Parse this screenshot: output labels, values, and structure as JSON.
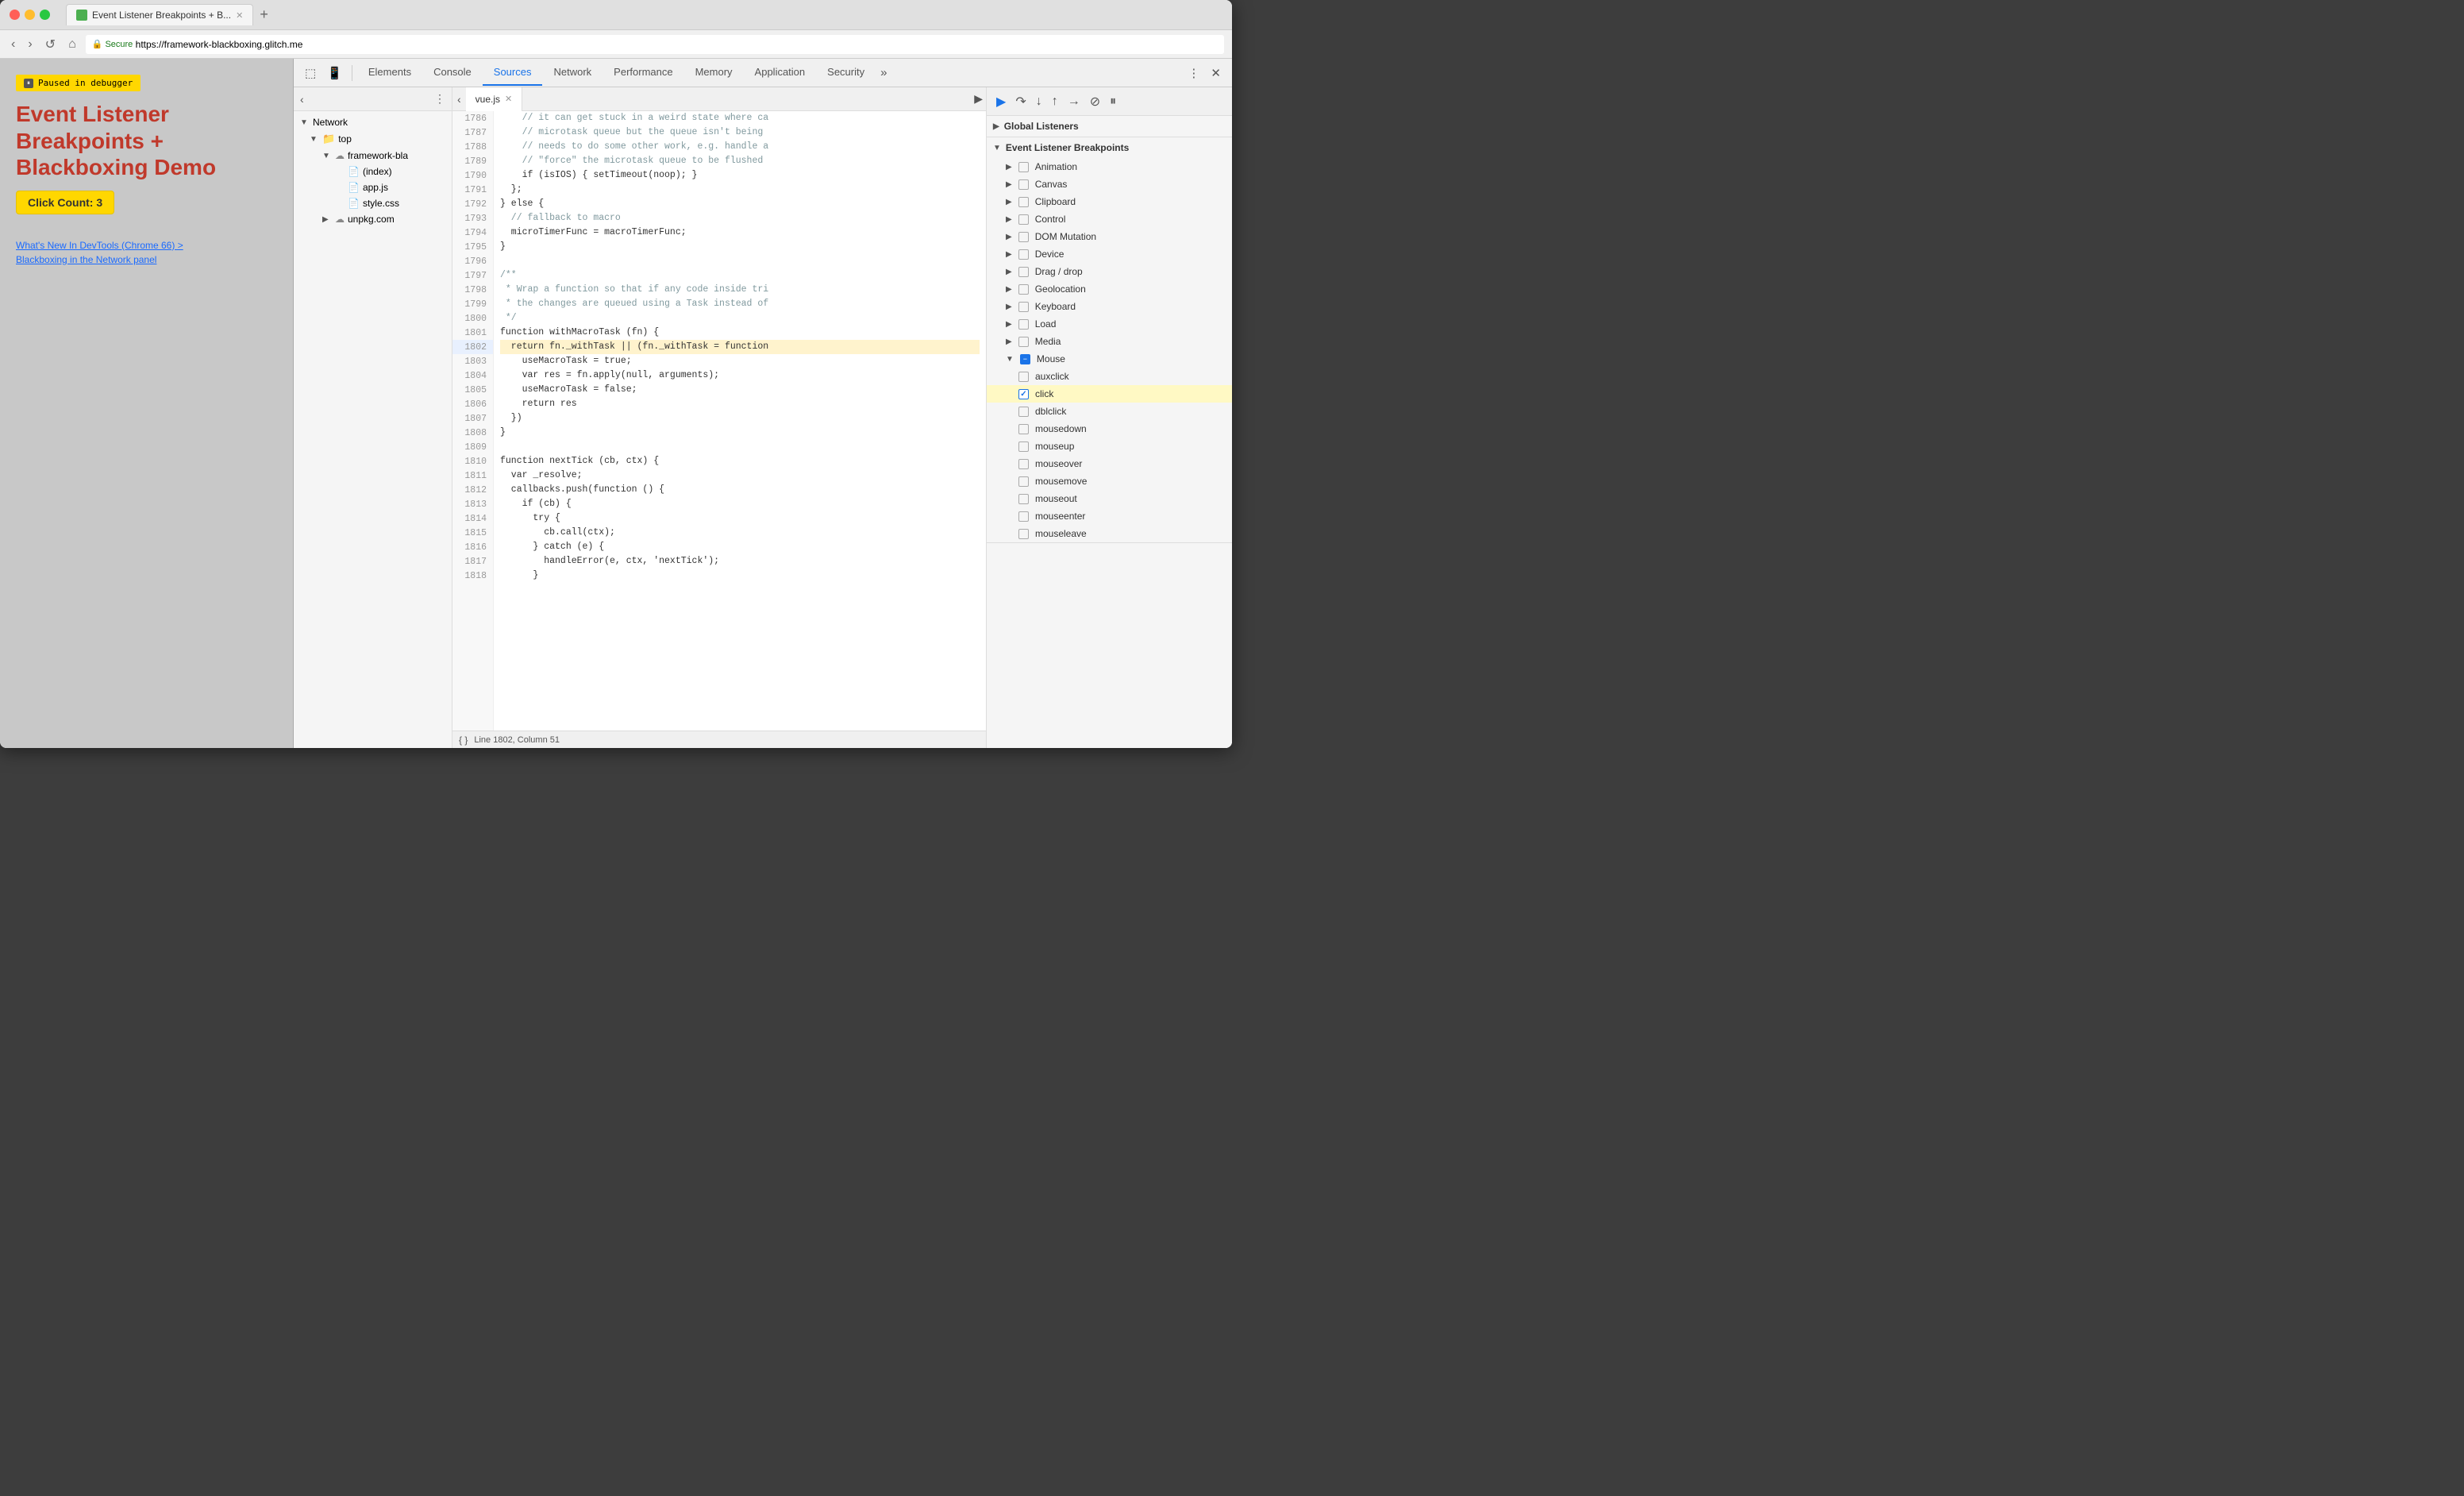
{
  "browser": {
    "tab_title": "Event Listener Breakpoints + B...",
    "url": "https://framework-blackboxing.glitch.me",
    "secure_text": "Secure"
  },
  "page": {
    "paused_label": "Paused in debugger",
    "title_line1": "Event Listener",
    "title_line2": "Breakpoints +",
    "title_line3": "Blackboxing Demo",
    "click_count": "Click Count: 3",
    "link1": "What's New In DevTools (Chrome 66) >",
    "link2": "Blackboxing in the Network panel"
  },
  "devtools": {
    "tabs": [
      {
        "id": "elements",
        "label": "Elements"
      },
      {
        "id": "console",
        "label": "Console"
      },
      {
        "id": "sources",
        "label": "Sources",
        "active": true
      },
      {
        "id": "network",
        "label": "Network"
      },
      {
        "id": "performance",
        "label": "Performance"
      },
      {
        "id": "memory",
        "label": "Memory"
      },
      {
        "id": "application",
        "label": "Application"
      },
      {
        "id": "security",
        "label": "Security"
      }
    ]
  },
  "file_panel": {
    "network_label": "Network",
    "top_label": "top",
    "framework_label": "framework-bla",
    "index_label": "(index)",
    "appjs_label": "app.js",
    "stylecss_label": "style.css",
    "unpkg_label": "unpkg.com"
  },
  "source_tab": {
    "filename": "vue.js"
  },
  "code": {
    "lines": [
      {
        "num": "1786",
        "text": "    // it can get stuck in a weird state where ca",
        "class": "c-comment"
      },
      {
        "num": "1787",
        "text": "    // microtask queue but the queue isn't being",
        "class": "c-comment"
      },
      {
        "num": "1788",
        "text": "    // needs to do some other work, e.g. handle a",
        "class": "c-comment"
      },
      {
        "num": "1789",
        "text": "    // \"force\" the microtask queue to be flushed",
        "class": "c-comment"
      },
      {
        "num": "1790",
        "text": "    if (isIOS) { setTimeout(noop); }",
        "class": "c-normal"
      },
      {
        "num": "1791",
        "text": "  };",
        "class": "c-normal"
      },
      {
        "num": "1792",
        "text": "} else {",
        "class": "c-normal"
      },
      {
        "num": "1793",
        "text": "  // fallback to macro",
        "class": "c-comment"
      },
      {
        "num": "1794",
        "text": "  microTimerFunc = macroTimerFunc;",
        "class": "c-normal"
      },
      {
        "num": "1795",
        "text": "}",
        "class": "c-normal"
      },
      {
        "num": "1796",
        "text": "",
        "class": "c-normal"
      },
      {
        "num": "1797",
        "text": "/**",
        "class": "c-comment"
      },
      {
        "num": "1798",
        "text": " * Wrap a function so that if any code inside tri",
        "class": "c-comment"
      },
      {
        "num": "1799",
        "text": " * the changes are queued using a Task instead of",
        "class": "c-comment"
      },
      {
        "num": "1800",
        "text": " */",
        "class": "c-comment"
      },
      {
        "num": "1801",
        "text": "function withMacroTask (fn) {",
        "class": "c-normal"
      },
      {
        "num": "1802",
        "text": "  return fn._withTask || (fn._withTask = function",
        "class": "c-normal",
        "breakpoint": true
      },
      {
        "num": "1803",
        "text": "    useMacroTask = true;",
        "class": "c-normal"
      },
      {
        "num": "1804",
        "text": "    var res = fn.apply(null, arguments);",
        "class": "c-normal"
      },
      {
        "num": "1805",
        "text": "    useMacroTask = false;",
        "class": "c-normal"
      },
      {
        "num": "1806",
        "text": "    return res",
        "class": "c-normal"
      },
      {
        "num": "1807",
        "text": "  })",
        "class": "c-normal"
      },
      {
        "num": "1808",
        "text": "}",
        "class": "c-normal"
      },
      {
        "num": "1809",
        "text": "",
        "class": "c-normal"
      },
      {
        "num": "1810",
        "text": "function nextTick (cb, ctx) {",
        "class": "c-normal"
      },
      {
        "num": "1811",
        "text": "  var _resolve;",
        "class": "c-normal"
      },
      {
        "num": "1812",
        "text": "  callbacks.push(function () {",
        "class": "c-normal"
      },
      {
        "num": "1813",
        "text": "    if (cb) {",
        "class": "c-normal"
      },
      {
        "num": "1814",
        "text": "      try {",
        "class": "c-normal"
      },
      {
        "num": "1815",
        "text": "        cb.call(ctx);",
        "class": "c-normal"
      },
      {
        "num": "1816",
        "text": "      } catch (e) {",
        "class": "c-normal"
      },
      {
        "num": "1817",
        "text": "        handleError(e, ctx, 'nextTick');",
        "class": "c-normal"
      },
      {
        "num": "1818",
        "text": "      }",
        "class": "c-normal"
      }
    ],
    "status": "Line 1802, Column 51"
  },
  "breakpoints": {
    "global_listeners_label": "Global Listeners",
    "event_listener_label": "Event Listener Breakpoints",
    "categories": [
      {
        "id": "animation",
        "label": "Animation",
        "expanded": false
      },
      {
        "id": "canvas",
        "label": "Canvas",
        "expanded": false
      },
      {
        "id": "clipboard",
        "label": "Clipboard",
        "expanded": false
      },
      {
        "id": "control",
        "label": "Control",
        "expanded": false
      },
      {
        "id": "dom-mutation",
        "label": "DOM Mutation",
        "expanded": false
      },
      {
        "id": "device",
        "label": "Device",
        "expanded": false
      },
      {
        "id": "drag-drop",
        "label": "Drag / drop",
        "expanded": false
      },
      {
        "id": "geolocation",
        "label": "Geolocation",
        "expanded": false
      },
      {
        "id": "keyboard",
        "label": "Keyboard",
        "expanded": false
      },
      {
        "id": "load",
        "label": "Load",
        "expanded": false
      },
      {
        "id": "media",
        "label": "Media",
        "expanded": false
      },
      {
        "id": "mouse",
        "label": "Mouse",
        "expanded": true
      }
    ],
    "mouse_items": [
      {
        "id": "auxclick",
        "label": "auxclick",
        "checked": false
      },
      {
        "id": "click",
        "label": "click",
        "checked": true,
        "highlighted": true
      },
      {
        "id": "dblclick",
        "label": "dblclick",
        "checked": false
      },
      {
        "id": "mousedown",
        "label": "mousedown",
        "checked": false
      },
      {
        "id": "mouseup",
        "label": "mouseup",
        "checked": false
      },
      {
        "id": "mouseover",
        "label": "mouseover",
        "checked": false
      },
      {
        "id": "mousemove",
        "label": "mousemove",
        "checked": false
      },
      {
        "id": "mouseout",
        "label": "mouseout",
        "checked": false
      },
      {
        "id": "mouseenter",
        "label": "mouseenter",
        "checked": false
      },
      {
        "id": "mouseleave",
        "label": "mouseleave",
        "checked": false
      }
    ]
  }
}
